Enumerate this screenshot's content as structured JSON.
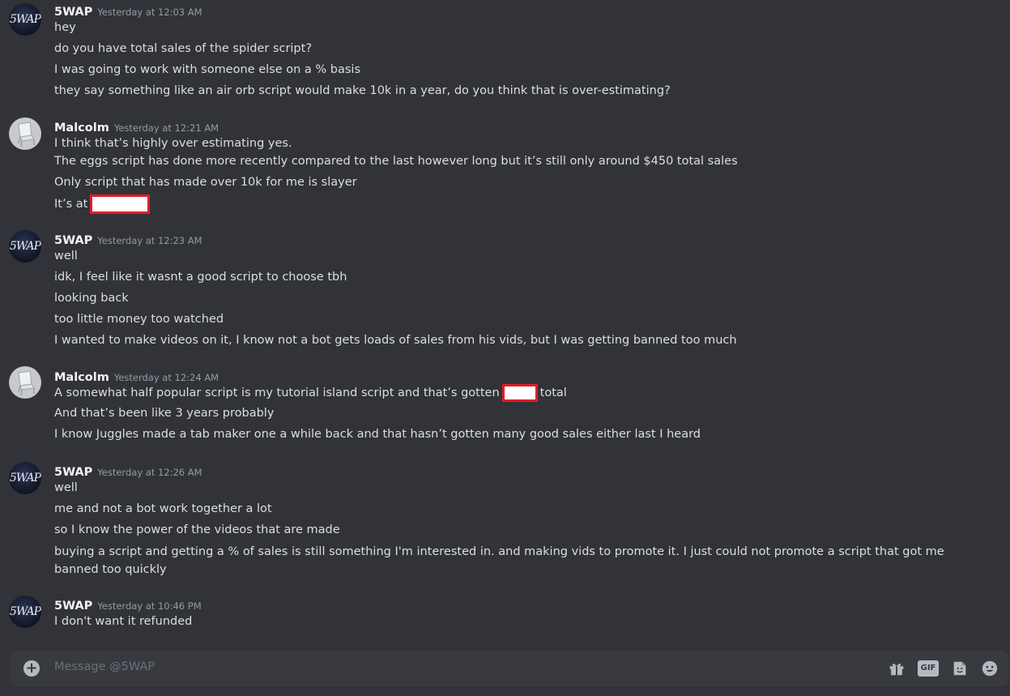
{
  "chat": {
    "groups": [
      {
        "author": "5WAP",
        "avatar_icon": "5wap-avatar-icon",
        "timestamp": "Yesterday at 12:03 AM",
        "messages": [
          "hey",
          "do you have total sales of the spider script?",
          "I was going to work with someone else on a % basis",
          "they say something like an air orb script would make 10k in a year, do you think that is over-estimating?"
        ]
      },
      {
        "author": "Malcolm",
        "avatar_icon": "malcolm-avatar-icon",
        "timestamp": "Yesterday at 12:21 AM",
        "messages": [
          "I think that’s highly over estimating yes.",
          "The eggs script has done more recently compared to the last however long but it’s still only around $450 total sales",
          "Only script that has made over 10k for me is slayer",
          "It’s at"
        ]
      },
      {
        "author": "5WAP",
        "avatar_icon": "5wap-avatar-icon",
        "timestamp": "Yesterday at 12:23 AM",
        "messages": [
          "well",
          "idk, I feel like it wasnt a good script to choose tbh",
          "looking back",
          "too little money too watched",
          "I wanted to make videos on it, I know not a bot gets loads of sales from his vids, but I was getting banned too much"
        ]
      },
      {
        "author": "Malcolm",
        "avatar_icon": "malcolm-avatar-icon",
        "timestamp": "Yesterday at 12:24 AM",
        "messages": [
          "A somewhat half popular script is my tutorial island script and that’s gotten",
          "total",
          "And that’s been like 3 years probably",
          "I know Juggles made a tab maker one a while back and that hasn’t gotten many good sales either last I heard"
        ]
      },
      {
        "author": "5WAP",
        "avatar_icon": "5wap-avatar-icon",
        "timestamp": "Yesterday at 12:26 AM",
        "messages": [
          "well",
          "me and not a bot work together a lot",
          "so I know the power of the videos that are made",
          "buying a script and getting a % of sales is still something I'm interested in. and making vids to promote it. I just could not promote a script that got me banned too quickly"
        ]
      },
      {
        "author": "5WAP",
        "avatar_icon": "5wap-avatar-icon",
        "timestamp": "Yesterday at 10:46 PM",
        "messages": [
          "I don't want it refunded"
        ]
      }
    ]
  },
  "avatar_logo_text": "5WAP",
  "composer": {
    "placeholder": "Message @5WAP",
    "gif_label": "GIF",
    "icons": [
      "add-circle-icon",
      "gift-icon",
      "gif-icon",
      "sticker-icon",
      "emoji-icon"
    ]
  },
  "colors": {
    "background": "#313338",
    "composer": "#383a40",
    "redaction": "#e11d2a"
  }
}
